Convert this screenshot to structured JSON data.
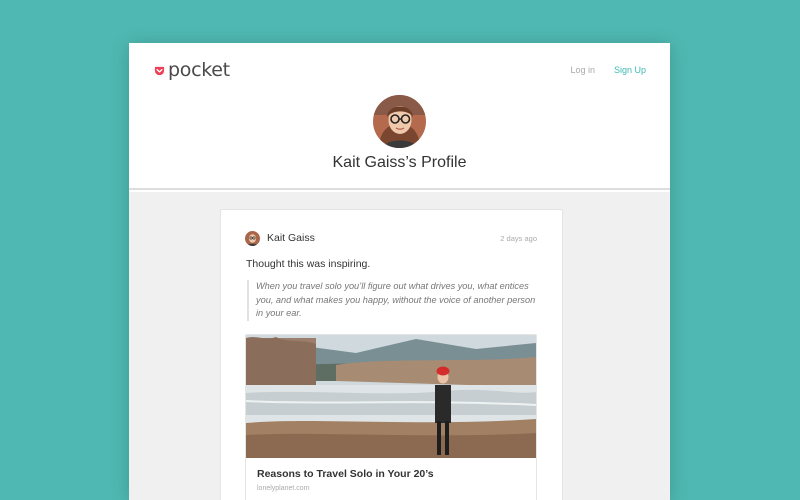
{
  "app": {
    "logo_text": "pocket",
    "brand_color": "#ee4056",
    "accent_color": "#3eb9b3",
    "background_color": "#4fb8b2"
  },
  "nav": {
    "login_label": "Log in",
    "signup_label": "Sign Up"
  },
  "profile": {
    "title": "Kait Gaiss’s Profile",
    "avatar_icon": "user-avatar"
  },
  "post": {
    "author": "Kait Gaiss",
    "timestamp": "2 days ago",
    "comment": "Thought this was inspiring.",
    "quote": "When you travel solo you’ll figure out what drives you, what entices you, and what makes you happy, without the voice of another person in your ear.",
    "article": {
      "title": "Reasons to Travel Solo in Your 20’s",
      "source": "lonelyplanet.com",
      "image_icon": "river-landscape-photo"
    }
  }
}
